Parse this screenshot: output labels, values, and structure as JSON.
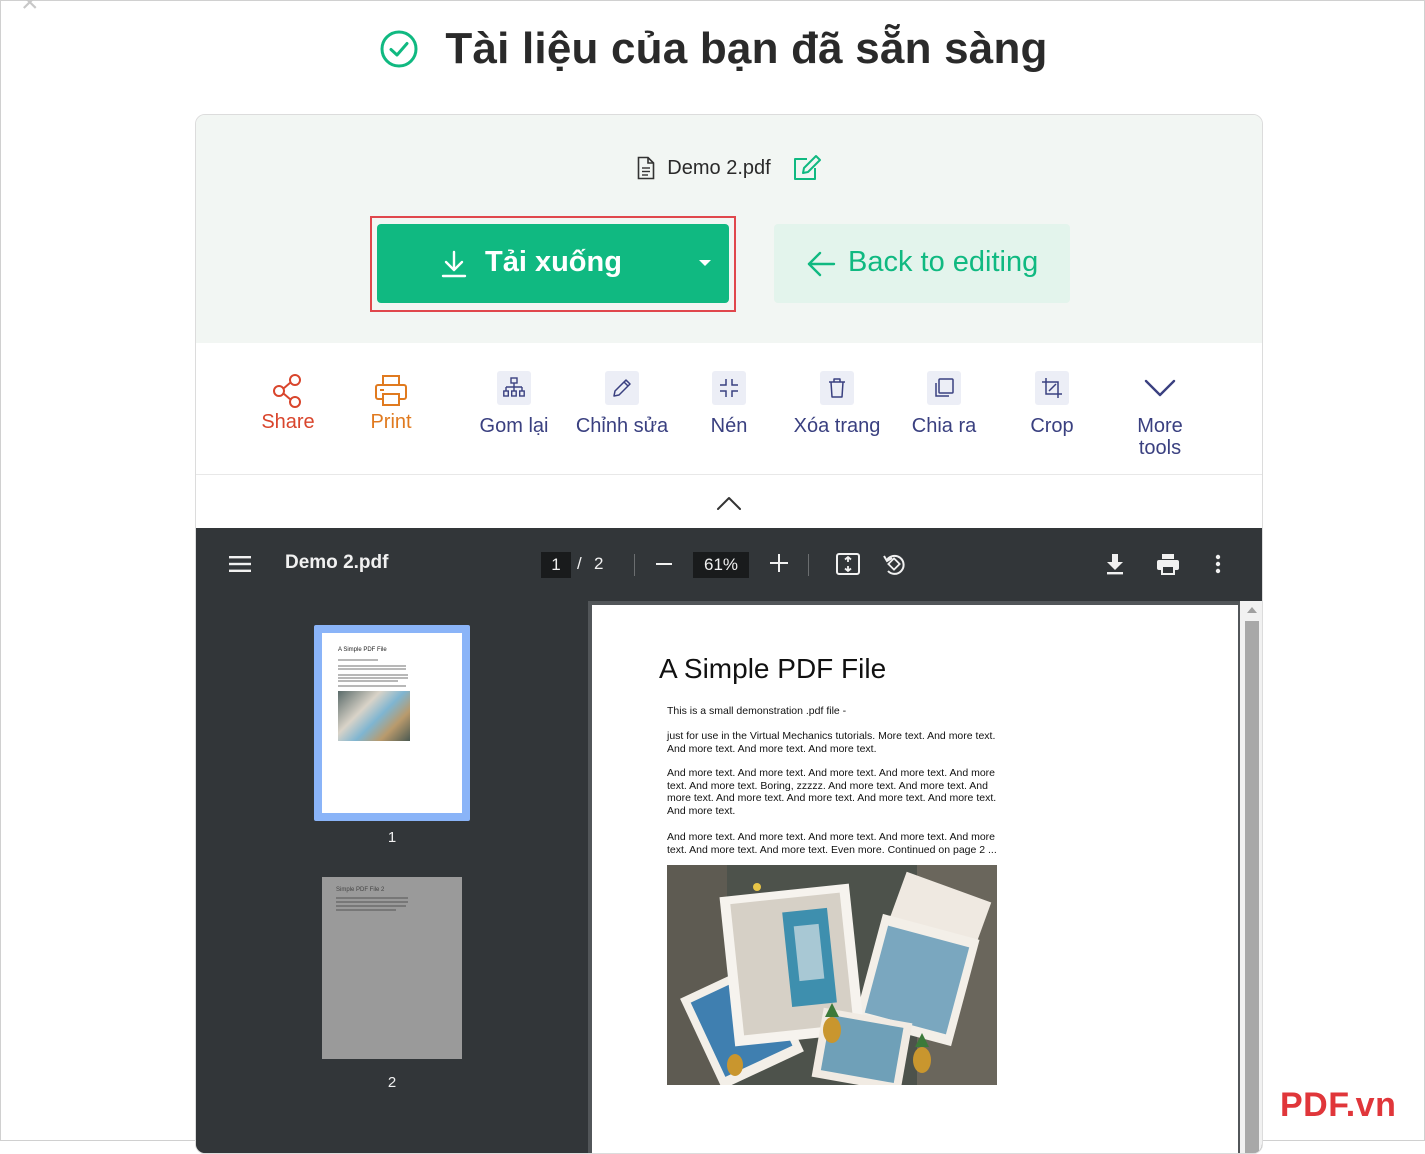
{
  "headline": {
    "title": "Tài liệu của bạn đã sẵn sàng"
  },
  "file": {
    "name": "Demo 2.pdf"
  },
  "actions": {
    "download_label": "Tải xuống",
    "back_label": "Back to editing"
  },
  "tools": [
    {
      "label": "Share",
      "icon": "share-icon"
    },
    {
      "label": "Print",
      "icon": "printer-icon"
    },
    {
      "label": "Gom lại",
      "icon": "merge-icon"
    },
    {
      "label": "Chỉnh sửa",
      "icon": "pencil-icon"
    },
    {
      "label": "Nén",
      "icon": "compress-icon"
    },
    {
      "label": "Xóa trang",
      "icon": "trash-icon"
    },
    {
      "label": "Chia ra",
      "icon": "split-icon"
    },
    {
      "label": "Crop",
      "icon": "crop-icon"
    },
    {
      "label": "More tools",
      "icon": "chevron-down-icon"
    }
  ],
  "viewer": {
    "title": "Demo 2.pdf",
    "current_page": "1",
    "page_separator": "/",
    "total_pages": "2",
    "zoom": "61%",
    "thumbnails": [
      {
        "number": "1",
        "title": "A Simple PDF File"
      },
      {
        "number": "2",
        "title": "Simple PDF File 2"
      }
    ]
  },
  "document": {
    "heading": "A Simple PDF File",
    "paragraphs": [
      "This is a small demonstration .pdf file -",
      "just for use in the Virtual Mechanics tutorials. More text. And more text. And more text. And more text. And more text.",
      "And more text. And more text. And more text. And more text. And more text. And more text. Boring, zzzzz. And more text. And more text. And more text. And more text. And more text. And more text. And more text. And more text.",
      "And more text. And more text. And more text. And more text. And more text. And more text. And more text. Even more. Continued on page 2 ..."
    ]
  },
  "watermark": "PDF.vn",
  "colors": {
    "accent": "#10b981",
    "highlight": "#e0474c",
    "tool_text": "#3a4080"
  }
}
